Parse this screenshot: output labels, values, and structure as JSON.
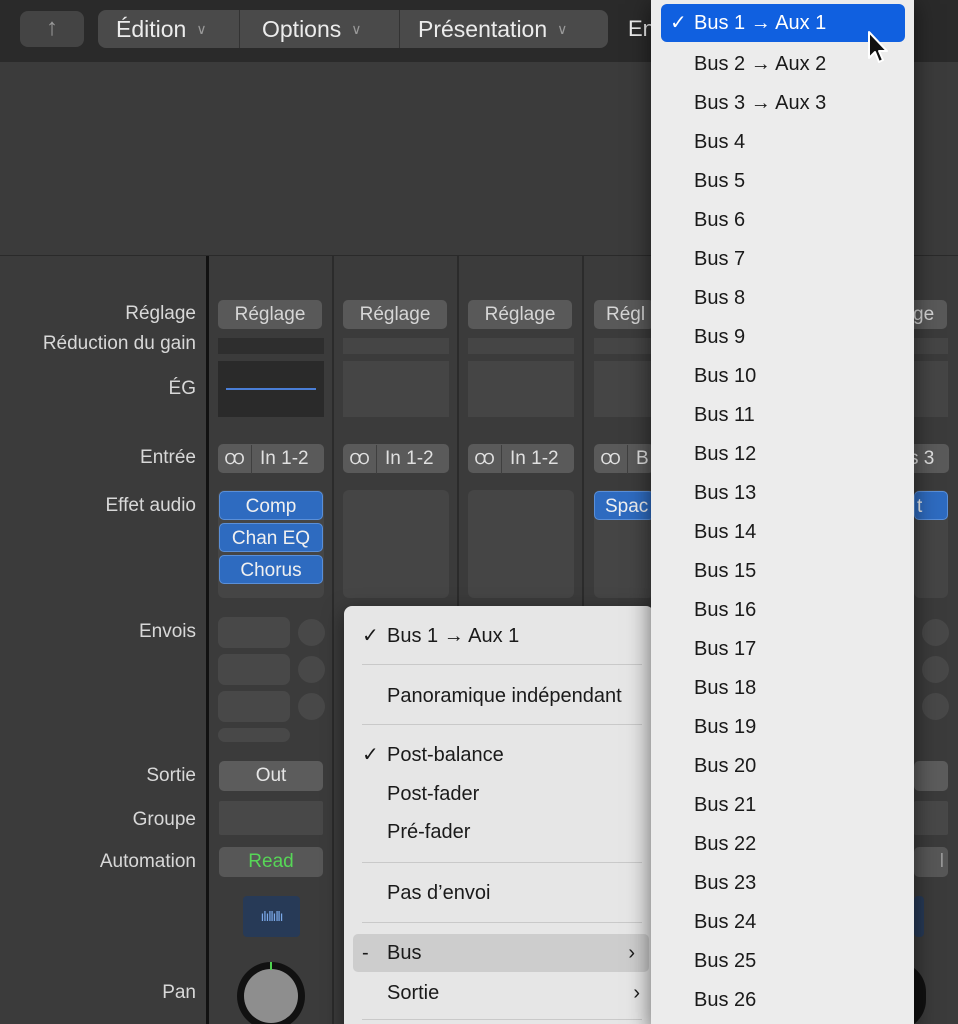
{
  "toolbar": {
    "up_icon": "↑",
    "menus": [
      {
        "label": "Édition",
        "chevron": "∨"
      },
      {
        "label": "Options",
        "chevron": "∨"
      },
      {
        "label": "Présentation",
        "chevron": "∨"
      }
    ],
    "partial_menu": "En"
  },
  "row_labels": {
    "setting": "Réglage",
    "gain_reduction": "Réduction du gain",
    "eq": "ÉG",
    "input": "Entrée",
    "audio_fx": "Effet audio",
    "sends": "Envois",
    "output": "Sortie",
    "group": "Groupe",
    "automation": "Automation",
    "pan": "Pan"
  },
  "strips": {
    "setting_label": "Réglage",
    "setting_partial_4": "Régl",
    "setting_partial_right": "ge",
    "input_link_icon": "Ꝏ",
    "input_label": "In 1-2",
    "input_partial_4": "B",
    "input_partial_right": "s 3",
    "strip1_plugins": [
      "Comp",
      "Chan EQ",
      "Chorus"
    ],
    "strip4_plugin_partial": "Spac",
    "right_plugin_partial": "t",
    "output_label": "Out",
    "automation_mode": "Read",
    "automation_partial_right": "l",
    "waveform_glyph": "ılıllıllı"
  },
  "send_menu": {
    "items": [
      {
        "label": "Bus 1 → Aux 1",
        "checked": true
      },
      {
        "label": "Panoramique indépendant",
        "checked": false
      },
      {
        "label": "Post-balance",
        "checked": true
      },
      {
        "label": "Post-fader",
        "checked": false
      },
      {
        "label": "Pré-fader",
        "checked": false
      },
      {
        "label": "Pas d’envoi",
        "checked": false
      },
      {
        "label": "Bus",
        "prefix": "-",
        "submenu": true,
        "highlighted": true
      },
      {
        "label": "Sortie",
        "submenu": true
      }
    ],
    "check_glyph": "✓",
    "submenu_arrow": "›"
  },
  "bus_submenu": {
    "selected": "Bus 1 → Aux 1",
    "items": [
      "Bus 1 → Aux 1",
      "Bus 2 → Aux 2",
      "Bus 3 → Aux 3",
      "Bus 4",
      "Bus 5",
      "Bus 6",
      "Bus 7",
      "Bus 8",
      "Bus 9",
      "Bus 10",
      "Bus 11",
      "Bus 12",
      "Bus 13",
      "Bus 14",
      "Bus 15",
      "Bus 16",
      "Bus 17",
      "Bus 18",
      "Bus 19",
      "Bus 20",
      "Bus 21",
      "Bus 22",
      "Bus 23",
      "Bus 24",
      "Bus 25",
      "Bus 26"
    ]
  },
  "colors": {
    "selection_blue": "#1060e0",
    "plugin_blue": "#2e6bc0",
    "read_green": "#57d657",
    "eq_line": "#4a7ed6"
  }
}
